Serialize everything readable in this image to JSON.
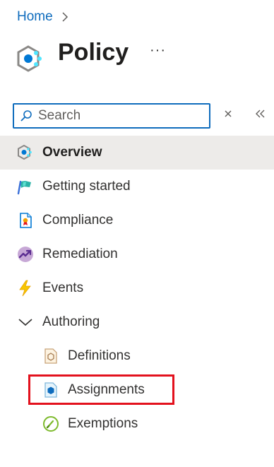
{
  "breadcrumb": {
    "home": "Home"
  },
  "header": {
    "title": "Policy",
    "more": "···"
  },
  "search": {
    "placeholder": "Search",
    "value": ""
  },
  "nav": {
    "items": [
      {
        "label": "Overview",
        "icon": "policy-icon",
        "selected": true
      },
      {
        "label": "Getting started",
        "icon": "flag-icon"
      },
      {
        "label": "Compliance",
        "icon": "compliance-icon"
      },
      {
        "label": "Remediation",
        "icon": "remediation-icon"
      },
      {
        "label": "Events",
        "icon": "lightning-icon"
      },
      {
        "label": "Authoring",
        "icon": "chevron-down-icon",
        "expanded": true
      },
      {
        "label": "Definitions",
        "icon": "definitions-icon",
        "indent": 1
      },
      {
        "label": "Assignments",
        "icon": "assignments-icon",
        "indent": 1,
        "highlighted": true
      },
      {
        "label": "Exemptions",
        "icon": "exemptions-icon",
        "indent": 1
      }
    ]
  },
  "colors": {
    "accent": "#0f6cbd",
    "highlight_border": "#e3111d",
    "selected_bg": "#edebe9"
  }
}
